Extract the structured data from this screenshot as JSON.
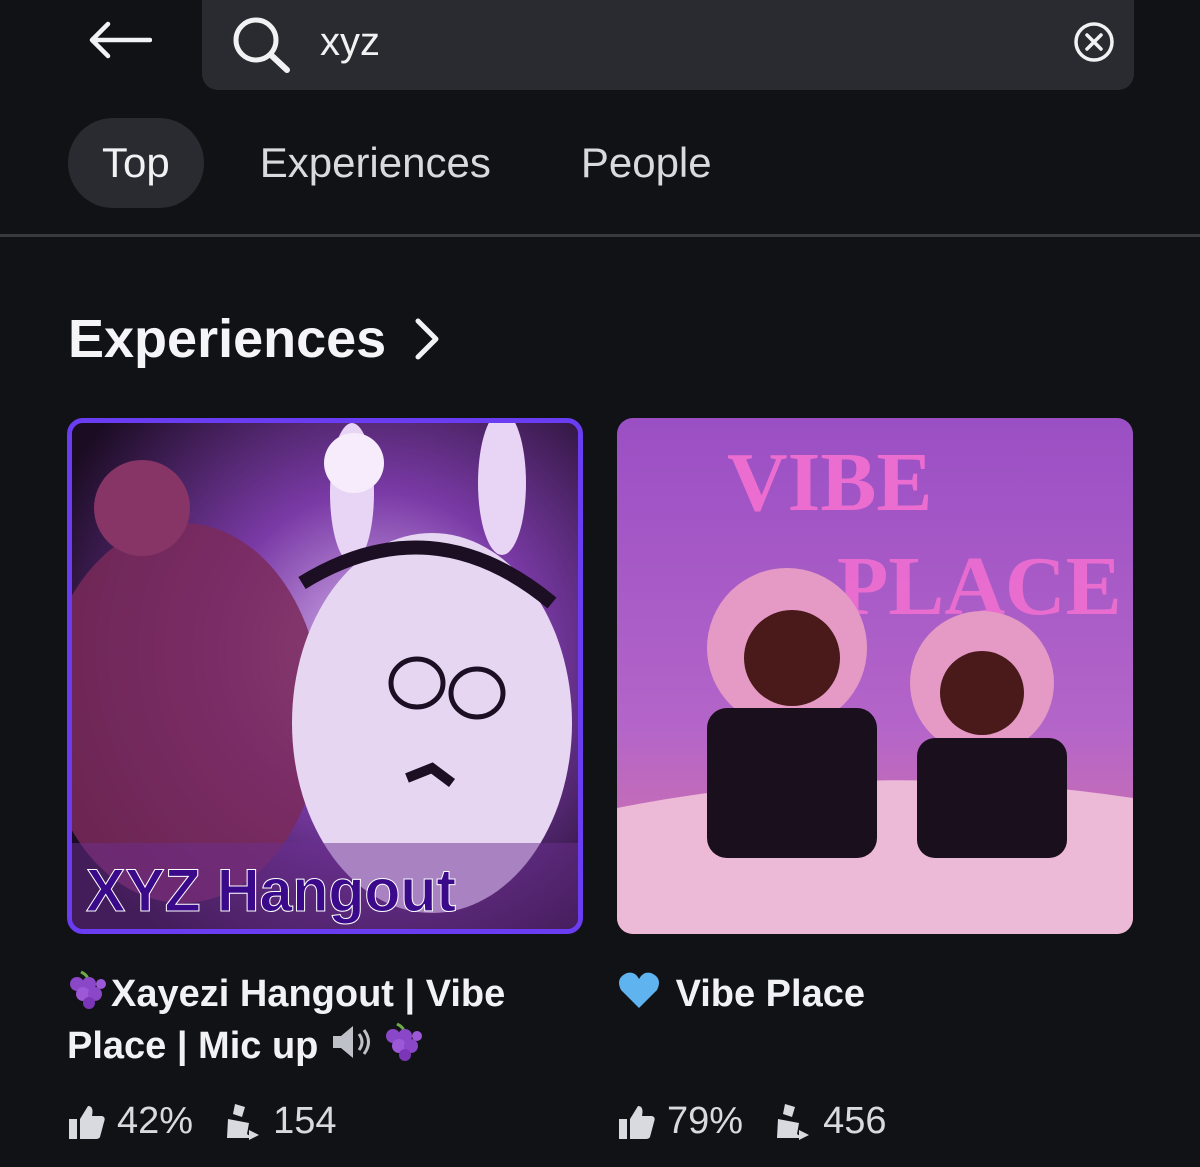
{
  "search": {
    "query": "xyz"
  },
  "tabs": [
    {
      "label": "Top",
      "active": true
    },
    {
      "label": "Experiences",
      "active": false
    },
    {
      "label": "People",
      "active": false
    }
  ],
  "section": {
    "title": "Experiences"
  },
  "experiences": [
    {
      "title": "Xayezi Hangout | Vibe Place | Mic up",
      "thumbnail_text": "XYZ Hangout",
      "title_icons": [
        "grapes-emoji",
        "speaker-emoji",
        "grapes-emoji"
      ],
      "rating": "42%",
      "players": "154",
      "selected": true
    },
    {
      "title": "Vibe Place",
      "thumbnail_text_line1": "VIBE",
      "thumbnail_text_line2": "PLACE",
      "title_icons": [
        "blue-heart-emoji"
      ],
      "rating": "79%",
      "players": "456",
      "selected": false
    }
  ],
  "icons": {
    "back": "back-arrow-icon",
    "search": "search-icon",
    "clear": "clear-icon",
    "chevron": "chevron-right-icon",
    "rating": "thumbs-up-icon",
    "players": "player-icon"
  },
  "colors": {
    "background": "#111216",
    "surface": "#2a2b30",
    "selected_border": "#6a3cf2"
  }
}
